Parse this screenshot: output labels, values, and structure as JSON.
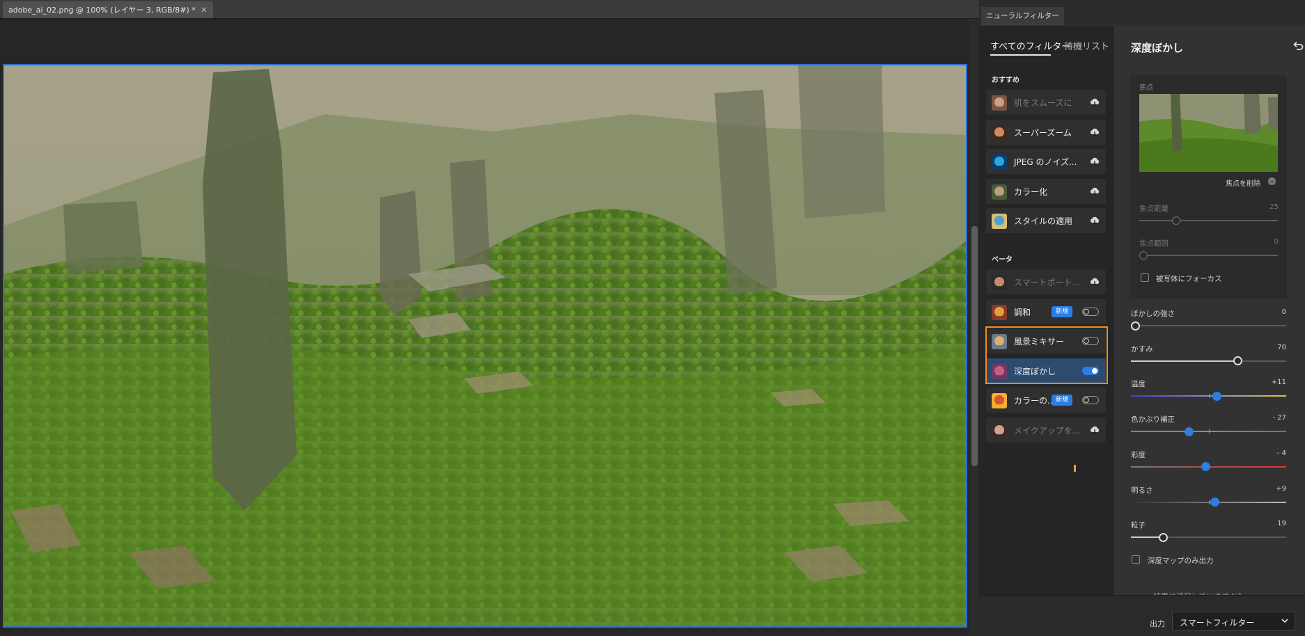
{
  "document": {
    "tab_title": "adobe_ai_02.png @ 100% (レイヤー 3, RGB/8#) *",
    "close_glyph": "×"
  },
  "panel": {
    "tab_title": "ニューラルフィルター",
    "list_tabs": [
      "すべてのフィルター",
      "待機リスト"
    ],
    "sections": {
      "featured": "おすすめ",
      "beta": "ベータ"
    },
    "featured_filters": [
      {
        "label": "肌をスムーズに",
        "icon": "face-portrait-icon",
        "state": "cloud-download",
        "disabled": true
      },
      {
        "label": "スーパーズーム",
        "icon": "superzoom-face-icon",
        "state": "cloud-download"
      },
      {
        "label": "JPEG のノイズ...",
        "icon": "jpeg-noise-icon",
        "state": "cloud-download"
      },
      {
        "label": "カラー化",
        "icon": "colorize-icon",
        "state": "cloud-download"
      },
      {
        "label": "スタイルの適用",
        "icon": "style-transfer-icon",
        "state": "cloud-download"
      }
    ],
    "beta_filters": [
      {
        "label": "スマートポート...",
        "icon": "smart-portrait-icon",
        "state": "cloud-download",
        "disabled": true
      },
      {
        "label": "調和",
        "icon": "harmonization-icon",
        "badge": "新規",
        "state": "toggle",
        "on": false
      },
      {
        "label": "風景ミキサー",
        "icon": "landscape-mixer-icon",
        "state": "toggle",
        "on": false
      },
      {
        "label": "深度ぼかし",
        "icon": "depth-blur-icon",
        "state": "toggle",
        "on": true,
        "active": true
      },
      {
        "label": "カラーの...",
        "icon": "color-transfer-icon",
        "badge": "新規",
        "state": "toggle",
        "on": false
      },
      {
        "label": "メイクアップを...",
        "icon": "makeup-transfer-icon",
        "state": "cloud-download",
        "disabled": true
      }
    ]
  },
  "settings": {
    "title": "深度ぼかし",
    "focus_label": "焦点",
    "remove_focus": "焦点を削除",
    "focal_distance": {
      "label": "焦点距離",
      "value": "25",
      "level": 0.25
    },
    "focal_range": {
      "label": "焦点範囲",
      "value": "0",
      "level": 0
    },
    "focus_subject": "被写体にフォーカス",
    "sliders": [
      {
        "label": "ぼかしの強さ",
        "value": "0",
        "type": "plain",
        "level": 0
      },
      {
        "label": "かすみ",
        "value": "70",
        "type": "plain",
        "level": 0.7
      },
      {
        "label": "温度",
        "value": "+11",
        "type": "temperature",
        "level": 0.555
      },
      {
        "label": "色かぶり補正",
        "value": "- 27",
        "type": "tint",
        "level": 0.365
      },
      {
        "label": "彩度",
        "value": "- 4",
        "type": "saturation",
        "level": 0.48
      },
      {
        "label": "明るさ",
        "value": "+9",
        "type": "brightness",
        "level": 0.545
      },
      {
        "label": "粒子",
        "value": "19",
        "type": "plain",
        "level": 0.19
      }
    ],
    "depth_map_only": "深度マップのみ出力",
    "cutoff_text": "結果に満足していますか？"
  },
  "output": {
    "label": "出力",
    "value": "スマートフィルター"
  },
  "colors": {
    "accent": "#2b7de9",
    "highlight": "#f28c1b",
    "active_row": "#2d4a6f"
  }
}
